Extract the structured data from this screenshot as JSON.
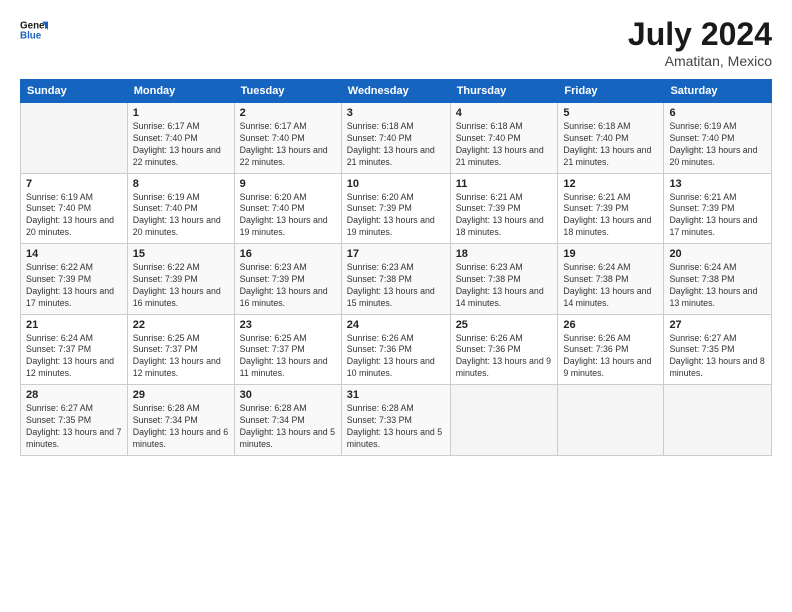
{
  "header": {
    "monthYear": "July 2024",
    "location": "Amatitan, Mexico"
  },
  "days": [
    "Sunday",
    "Monday",
    "Tuesday",
    "Wednesday",
    "Thursday",
    "Friday",
    "Saturday"
  ],
  "weeks": [
    [
      {
        "num": "",
        "sunrise": "",
        "sunset": "",
        "daylight": "",
        "empty": true
      },
      {
        "num": "1",
        "sunrise": "Sunrise: 6:17 AM",
        "sunset": "Sunset: 7:40 PM",
        "daylight": "Daylight: 13 hours and 22 minutes.",
        "empty": false
      },
      {
        "num": "2",
        "sunrise": "Sunrise: 6:17 AM",
        "sunset": "Sunset: 7:40 PM",
        "daylight": "Daylight: 13 hours and 22 minutes.",
        "empty": false
      },
      {
        "num": "3",
        "sunrise": "Sunrise: 6:18 AM",
        "sunset": "Sunset: 7:40 PM",
        "daylight": "Daylight: 13 hours and 21 minutes.",
        "empty": false
      },
      {
        "num": "4",
        "sunrise": "Sunrise: 6:18 AM",
        "sunset": "Sunset: 7:40 PM",
        "daylight": "Daylight: 13 hours and 21 minutes.",
        "empty": false
      },
      {
        "num": "5",
        "sunrise": "Sunrise: 6:18 AM",
        "sunset": "Sunset: 7:40 PM",
        "daylight": "Daylight: 13 hours and 21 minutes.",
        "empty": false
      },
      {
        "num": "6",
        "sunrise": "Sunrise: 6:19 AM",
        "sunset": "Sunset: 7:40 PM",
        "daylight": "Daylight: 13 hours and 20 minutes.",
        "empty": false
      }
    ],
    [
      {
        "num": "7",
        "sunrise": "Sunrise: 6:19 AM",
        "sunset": "Sunset: 7:40 PM",
        "daylight": "Daylight: 13 hours and 20 minutes.",
        "empty": false
      },
      {
        "num": "8",
        "sunrise": "Sunrise: 6:19 AM",
        "sunset": "Sunset: 7:40 PM",
        "daylight": "Daylight: 13 hours and 20 minutes.",
        "empty": false
      },
      {
        "num": "9",
        "sunrise": "Sunrise: 6:20 AM",
        "sunset": "Sunset: 7:40 PM",
        "daylight": "Daylight: 13 hours and 19 minutes.",
        "empty": false
      },
      {
        "num": "10",
        "sunrise": "Sunrise: 6:20 AM",
        "sunset": "Sunset: 7:39 PM",
        "daylight": "Daylight: 13 hours and 19 minutes.",
        "empty": false
      },
      {
        "num": "11",
        "sunrise": "Sunrise: 6:21 AM",
        "sunset": "Sunset: 7:39 PM",
        "daylight": "Daylight: 13 hours and 18 minutes.",
        "empty": false
      },
      {
        "num": "12",
        "sunrise": "Sunrise: 6:21 AM",
        "sunset": "Sunset: 7:39 PM",
        "daylight": "Daylight: 13 hours and 18 minutes.",
        "empty": false
      },
      {
        "num": "13",
        "sunrise": "Sunrise: 6:21 AM",
        "sunset": "Sunset: 7:39 PM",
        "daylight": "Daylight: 13 hours and 17 minutes.",
        "empty": false
      }
    ],
    [
      {
        "num": "14",
        "sunrise": "Sunrise: 6:22 AM",
        "sunset": "Sunset: 7:39 PM",
        "daylight": "Daylight: 13 hours and 17 minutes.",
        "empty": false
      },
      {
        "num": "15",
        "sunrise": "Sunrise: 6:22 AM",
        "sunset": "Sunset: 7:39 PM",
        "daylight": "Daylight: 13 hours and 16 minutes.",
        "empty": false
      },
      {
        "num": "16",
        "sunrise": "Sunrise: 6:23 AM",
        "sunset": "Sunset: 7:39 PM",
        "daylight": "Daylight: 13 hours and 16 minutes.",
        "empty": false
      },
      {
        "num": "17",
        "sunrise": "Sunrise: 6:23 AM",
        "sunset": "Sunset: 7:38 PM",
        "daylight": "Daylight: 13 hours and 15 minutes.",
        "empty": false
      },
      {
        "num": "18",
        "sunrise": "Sunrise: 6:23 AM",
        "sunset": "Sunset: 7:38 PM",
        "daylight": "Daylight: 13 hours and 14 minutes.",
        "empty": false
      },
      {
        "num": "19",
        "sunrise": "Sunrise: 6:24 AM",
        "sunset": "Sunset: 7:38 PM",
        "daylight": "Daylight: 13 hours and 14 minutes.",
        "empty": false
      },
      {
        "num": "20",
        "sunrise": "Sunrise: 6:24 AM",
        "sunset": "Sunset: 7:38 PM",
        "daylight": "Daylight: 13 hours and 13 minutes.",
        "empty": false
      }
    ],
    [
      {
        "num": "21",
        "sunrise": "Sunrise: 6:24 AM",
        "sunset": "Sunset: 7:37 PM",
        "daylight": "Daylight: 13 hours and 12 minutes.",
        "empty": false
      },
      {
        "num": "22",
        "sunrise": "Sunrise: 6:25 AM",
        "sunset": "Sunset: 7:37 PM",
        "daylight": "Daylight: 13 hours and 12 minutes.",
        "empty": false
      },
      {
        "num": "23",
        "sunrise": "Sunrise: 6:25 AM",
        "sunset": "Sunset: 7:37 PM",
        "daylight": "Daylight: 13 hours and 11 minutes.",
        "empty": false
      },
      {
        "num": "24",
        "sunrise": "Sunrise: 6:26 AM",
        "sunset": "Sunset: 7:36 PM",
        "daylight": "Daylight: 13 hours and 10 minutes.",
        "empty": false
      },
      {
        "num": "25",
        "sunrise": "Sunrise: 6:26 AM",
        "sunset": "Sunset: 7:36 PM",
        "daylight": "Daylight: 13 hours and 9 minutes.",
        "empty": false
      },
      {
        "num": "26",
        "sunrise": "Sunrise: 6:26 AM",
        "sunset": "Sunset: 7:36 PM",
        "daylight": "Daylight: 13 hours and 9 minutes.",
        "empty": false
      },
      {
        "num": "27",
        "sunrise": "Sunrise: 6:27 AM",
        "sunset": "Sunset: 7:35 PM",
        "daylight": "Daylight: 13 hours and 8 minutes.",
        "empty": false
      }
    ],
    [
      {
        "num": "28",
        "sunrise": "Sunrise: 6:27 AM",
        "sunset": "Sunset: 7:35 PM",
        "daylight": "Daylight: 13 hours and 7 minutes.",
        "empty": false
      },
      {
        "num": "29",
        "sunrise": "Sunrise: 6:28 AM",
        "sunset": "Sunset: 7:34 PM",
        "daylight": "Daylight: 13 hours and 6 minutes.",
        "empty": false
      },
      {
        "num": "30",
        "sunrise": "Sunrise: 6:28 AM",
        "sunset": "Sunset: 7:34 PM",
        "daylight": "Daylight: 13 hours and 5 minutes.",
        "empty": false
      },
      {
        "num": "31",
        "sunrise": "Sunrise: 6:28 AM",
        "sunset": "Sunset: 7:33 PM",
        "daylight": "Daylight: 13 hours and 5 minutes.",
        "empty": false
      },
      {
        "num": "",
        "sunrise": "",
        "sunset": "",
        "daylight": "",
        "empty": true
      },
      {
        "num": "",
        "sunrise": "",
        "sunset": "",
        "daylight": "",
        "empty": true
      },
      {
        "num": "",
        "sunrise": "",
        "sunset": "",
        "daylight": "",
        "empty": true
      }
    ]
  ]
}
